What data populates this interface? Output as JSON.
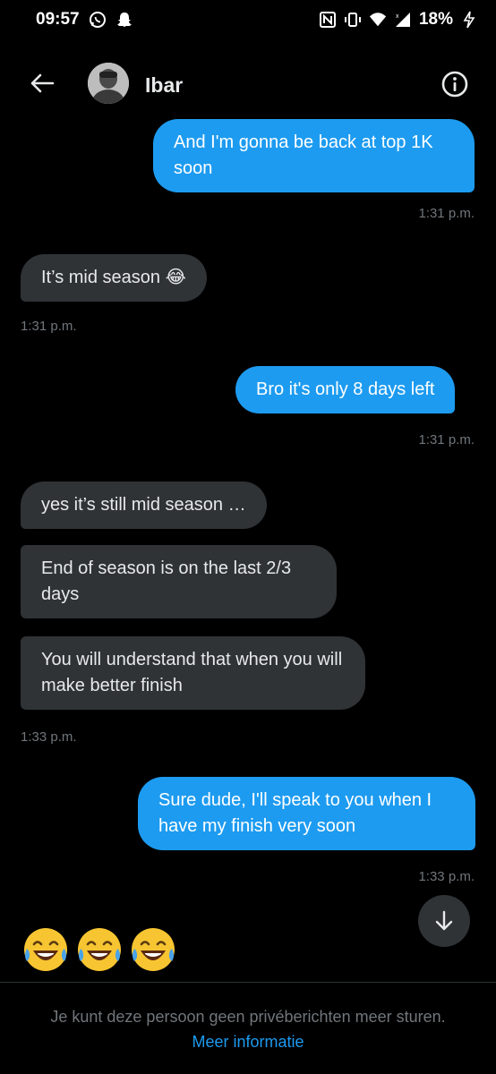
{
  "status_bar": {
    "time": "09:57",
    "battery": "18%",
    "icons": [
      "whatsapp-icon",
      "snapchat-icon",
      "nfc-icon",
      "vibrate-icon",
      "wifi-icon",
      "signal-icon",
      "charging-icon"
    ]
  },
  "header": {
    "contact_name": "Ibar",
    "back_icon": "arrow-left-icon",
    "info_icon": "info-icon"
  },
  "messages": [
    {
      "direction": "out",
      "text": "And I'm gonna be back at top 1K soon"
    },
    {
      "direction": "out",
      "timestamp": "1:31 p.m."
    },
    {
      "direction": "in",
      "text": "It’s mid season 😂"
    },
    {
      "direction": "in",
      "timestamp": "1:31 p.m."
    },
    {
      "direction": "out",
      "text": "Bro it's only 8 days left"
    },
    {
      "direction": "out",
      "timestamp": "1:31 p.m."
    },
    {
      "direction": "in",
      "text": "yes it’s still mid season …"
    },
    {
      "direction": "in",
      "text": "End of season is on the last 2/3 days"
    },
    {
      "direction": "in",
      "text": "You will understand that when you will make better finish"
    },
    {
      "direction": "in",
      "timestamp": "1:33 p.m."
    },
    {
      "direction": "out",
      "text": "Sure dude, I'll speak to you when I have my finish very soon"
    },
    {
      "direction": "out",
      "timestamp": "1:33 p.m."
    }
  ],
  "emoji_message": [
    "😂",
    "😂",
    "😂"
  ],
  "footer": {
    "notice": "Je kunt deze persoon geen privéberichten meer sturen.",
    "link": "Meer informatie"
  },
  "colors": {
    "background": "#000000",
    "outgoing_bubble": "#1d9bf0",
    "incoming_bubble": "#2f3336",
    "secondary_text": "#71767b",
    "link": "#1d9bf0"
  }
}
